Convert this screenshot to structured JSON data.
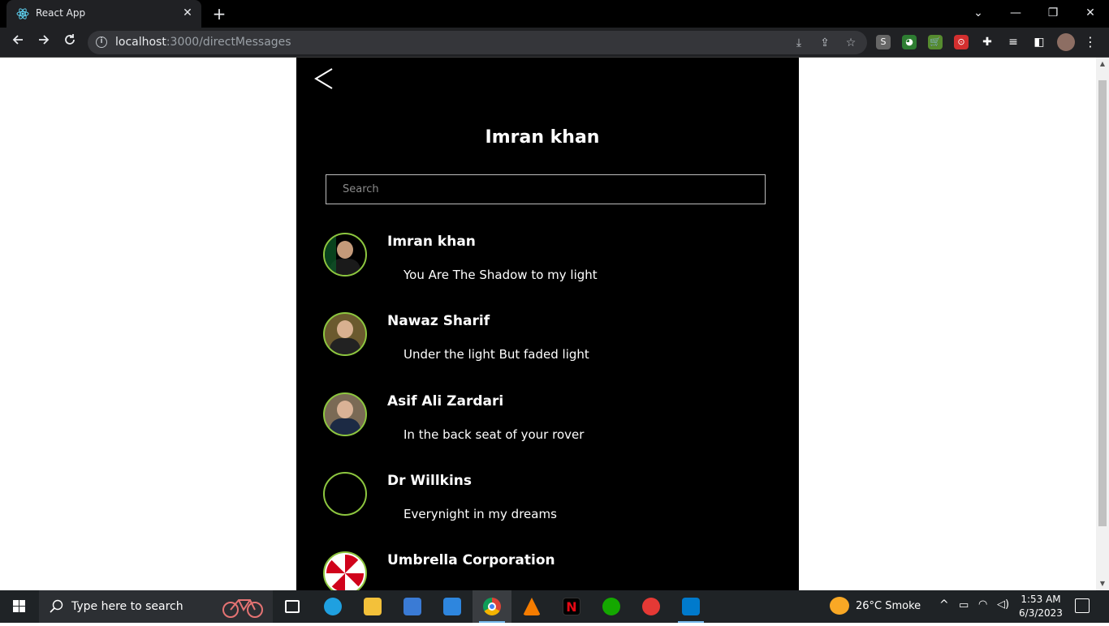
{
  "browser": {
    "tab_title": "React App",
    "tab_close": "✕",
    "new_tab": "+",
    "url_host": "localhost",
    "url_rest": ":3000/directMessages",
    "window_controls": [
      "⌄",
      "—",
      "❐",
      "✕"
    ]
  },
  "app": {
    "heading": "Imran khan",
    "search_placeholder": "Search",
    "contacts": [
      {
        "name": "Imran khan",
        "message": "You Are The Shadow to my light",
        "avatar": "photo"
      },
      {
        "name": "Nawaz Sharif",
        "message": "Under the light But faded light",
        "avatar": "photo"
      },
      {
        "name": "Asif Ali Zardari",
        "message": "In the back seat of your rover",
        "avatar": "photo"
      },
      {
        "name": "Dr Willkins",
        "message": "Everynight in my dreams",
        "avatar": "empty"
      },
      {
        "name": "Umbrella Corporation",
        "message": "",
        "avatar": "umbrella-logo"
      }
    ]
  },
  "taskbar": {
    "search_text": "Type here to search",
    "weather": "26°C  Smoke",
    "time": "1:53 AM",
    "date": "6/3/2023"
  },
  "colors": {
    "avatar_ring": "#8dc63f",
    "panel_bg": "#000000"
  }
}
